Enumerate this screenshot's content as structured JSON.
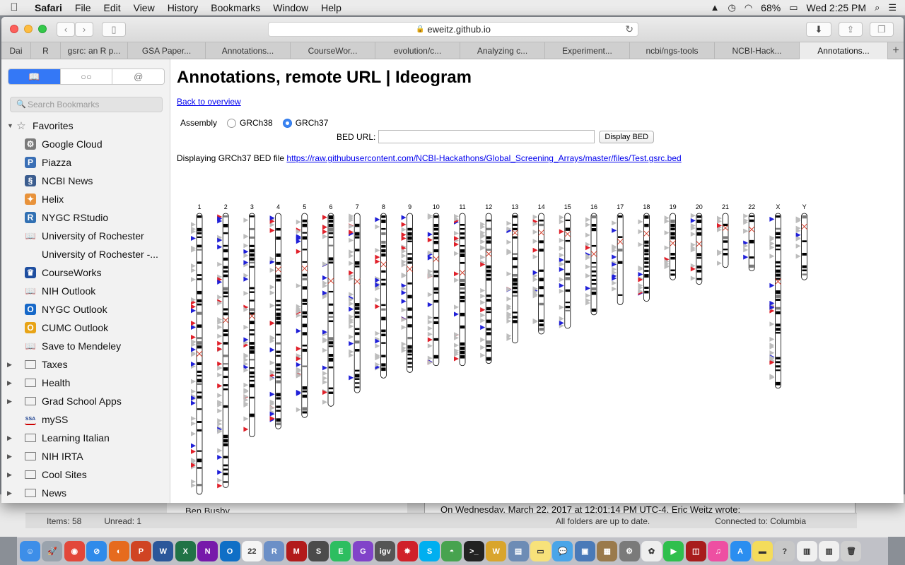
{
  "menubar": {
    "app": "Safari",
    "items": [
      "File",
      "Edit",
      "View",
      "History",
      "Bookmarks",
      "Window",
      "Help"
    ],
    "battery": "68%",
    "clock": "Wed 2:25 PM"
  },
  "browser": {
    "url": "eweitz.github.io",
    "tabs": [
      "Dai",
      "R",
      "gsrc: an R p...",
      "GSA Paper...",
      "Annotations...",
      "CourseWor...",
      "evolution/c...",
      "Analyzing c...",
      "Experiment...",
      "ncbi/ngs-tools",
      "NCBI-Hack...",
      "Annotations..."
    ],
    "new_tab": "+"
  },
  "sidebar": {
    "search_placeholder": "Search Bookmarks",
    "segments": [
      "book-icon",
      "glasses-icon",
      "at-icon"
    ],
    "at_label": "@",
    "favorites_label": "Favorites",
    "items": [
      {
        "label": "Google Cloud",
        "icon": "gear-icon",
        "color": "#7a7a7a",
        "glyph": "⚙"
      },
      {
        "label": "Piazza",
        "icon": "piazza-icon",
        "color": "#3a6fb5",
        "glyph": "P"
      },
      {
        "label": "NCBI News",
        "icon": "ncbi-icon",
        "color": "#3b5d8f",
        "glyph": "§"
      },
      {
        "label": "Helix",
        "icon": "helix-icon",
        "color": "#e8923a",
        "glyph": "✦"
      },
      {
        "label": "NYGC RStudio",
        "icon": "rstudio-icon",
        "color": "#3170b3",
        "glyph": "R"
      },
      {
        "label": "University of Rochester",
        "icon": "book-icon",
        "color": "",
        "glyph": "📖"
      },
      {
        "label": "University of Rochester -...",
        "icon": "",
        "color": "",
        "glyph": ""
      },
      {
        "label": "CourseWorks",
        "icon": "crown-icon",
        "color": "#1f4fa0",
        "glyph": "♛"
      },
      {
        "label": "NIH Outlook",
        "icon": "book-icon",
        "color": "",
        "glyph": "📖"
      },
      {
        "label": "NYGC Outlook",
        "icon": "outlook-icon",
        "color": "#1668c8",
        "glyph": "O"
      },
      {
        "label": "CUMC Outlook",
        "icon": "outlook-icon",
        "color": "#e8a417",
        "glyph": "O"
      },
      {
        "label": "Save to Mendeley",
        "icon": "book-icon",
        "color": "",
        "glyph": "📖"
      }
    ],
    "folders": [
      "Taxes",
      "Health",
      "Grad School Apps",
      "mySS",
      "Learning Italian",
      "NIH IRTA",
      "Cool Sites",
      "News"
    ],
    "myss_badge": "SSA"
  },
  "page": {
    "title": "Annotations, remote URL | Ideogram",
    "back_link": "Back to overview",
    "assembly_label": "Assembly",
    "assembly_options": [
      "GRCh38",
      "GRCh37"
    ],
    "assembly_selected": "GRCh37",
    "bed_url_label": "BED URL:",
    "bed_url_value": "",
    "display_button": "Display BED",
    "displaying_prefix": "Displaying GRCh37 BED file",
    "displaying_link": "https://raw.githubusercontent.com/NCBI-Hackathons/Global_Screening_Arrays/master/files/Test.gsrc.bed"
  },
  "ideogram": {
    "chromosomes": [
      {
        "name": "1",
        "length": 249,
        "centromere": 0.5
      },
      {
        "name": "2",
        "length": 243,
        "centromere": 0.39
      },
      {
        "name": "3",
        "length": 198,
        "centromere": 0.46
      },
      {
        "name": "4",
        "length": 191,
        "centromere": 0.26
      },
      {
        "name": "5",
        "length": 181,
        "centromere": 0.27
      },
      {
        "name": "6",
        "length": 171,
        "centromere": 0.35
      },
      {
        "name": "7",
        "length": 159,
        "centromere": 0.38
      },
      {
        "name": "8",
        "length": 146,
        "centromere": 0.31
      },
      {
        "name": "9",
        "length": 141,
        "centromere": 0.35
      },
      {
        "name": "10",
        "length": 135,
        "centromere": 0.3
      },
      {
        "name": "11",
        "length": 135,
        "centromere": 0.39
      },
      {
        "name": "12",
        "length": 133,
        "centromere": 0.27
      },
      {
        "name": "13",
        "length": 115,
        "centromere": 0.15
      },
      {
        "name": "14",
        "length": 107,
        "centromere": 0.16
      },
      {
        "name": "15",
        "length": 102,
        "centromere": 0.18
      },
      {
        "name": "16",
        "length": 90,
        "centromere": 0.4
      },
      {
        "name": "17",
        "length": 81,
        "centromere": 0.31
      },
      {
        "name": "18",
        "length": 78,
        "centromere": 0.23
      },
      {
        "name": "19",
        "length": 59,
        "centromere": 0.45
      },
      {
        "name": "20",
        "length": 63,
        "centromere": 0.43
      },
      {
        "name": "21",
        "length": 48,
        "centromere": 0.27
      },
      {
        "name": "22",
        "length": 51,
        "centromere": 0.28
      },
      {
        "name": "X",
        "length": 155,
        "centromere": 0.39
      },
      {
        "name": "Y",
        "length": 59,
        "centromere": 0.2
      }
    ],
    "colors": {
      "gain": "#e0202a",
      "loss": "#2020d8",
      "neutral": "#bdbdbd",
      "band": "#000000",
      "acen": "#d0331f",
      "gvar": "#c8c8f0"
    }
  },
  "mail": {
    "items_count": "Items: 58",
    "unread": "Unread: 1",
    "sync": "All folders are up to date.",
    "connection": "Connected to: Columbia",
    "quote": "On Wednesday, March 22, 2017 at 12:01:14 PM UTC-4, Eric Weitz wrote:",
    "sender": "Ben Busby"
  },
  "dock": {
    "apps": [
      {
        "name": "finder-icon",
        "color": "#3d8ee8",
        "glyph": "☺"
      },
      {
        "name": "launchpad-icon",
        "color": "#9aa3ad",
        "glyph": "🚀"
      },
      {
        "name": "chrome-icon",
        "color": "#e2473a",
        "glyph": "◉"
      },
      {
        "name": "safari-icon",
        "color": "#2f8bea",
        "glyph": "⊘"
      },
      {
        "name": "firefox-icon",
        "color": "#e66b1e",
        "glyph": "◐"
      },
      {
        "name": "powerpoint-icon",
        "color": "#d04423",
        "glyph": "P"
      },
      {
        "name": "word-icon",
        "color": "#2b579a",
        "glyph": "W"
      },
      {
        "name": "excel-icon",
        "color": "#217346",
        "glyph": "X"
      },
      {
        "name": "onenote-icon",
        "color": "#7719aa",
        "glyph": "N"
      },
      {
        "name": "outlook-icon",
        "color": "#0f6fc6",
        "glyph": "O"
      },
      {
        "name": "calendar-icon",
        "color": "#f5f5f5",
        "glyph": "22"
      },
      {
        "name": "r-icon",
        "color": "#6b8fc7",
        "glyph": "R"
      },
      {
        "name": "mendeley-icon",
        "color": "#b21b1b",
        "glyph": "M"
      },
      {
        "name": "sublime-icon",
        "color": "#4b4b4b",
        "glyph": "S"
      },
      {
        "name": "evernote-icon",
        "color": "#2dbe60",
        "glyph": "E"
      },
      {
        "name": "github-icon",
        "color": "#8143c9",
        "glyph": "G"
      },
      {
        "name": "igv-icon",
        "color": "#555",
        "glyph": "igv"
      },
      {
        "name": "settings-icon",
        "color": "#d0212a",
        "glyph": "✸"
      },
      {
        "name": "skype-icon",
        "color": "#00aff0",
        "glyph": "S"
      },
      {
        "name": "network-icon",
        "color": "#47a34f",
        "glyph": "◓"
      },
      {
        "name": "terminal-icon",
        "color": "#222",
        "glyph": ">_"
      },
      {
        "name": "wunderlist-icon",
        "color": "#d9a52c",
        "glyph": "W"
      },
      {
        "name": "preview-icon",
        "color": "#6d8cb5",
        "glyph": "▤"
      },
      {
        "name": "notes-icon",
        "color": "#f7e27a",
        "glyph": "▭"
      },
      {
        "name": "messages-icon",
        "color": "#4aa5e8",
        "glyph": "💬"
      },
      {
        "name": "photo-icon",
        "color": "#4a7ab8",
        "glyph": "▣"
      },
      {
        "name": "archive-icon",
        "color": "#9a7a4c",
        "glyph": "▦"
      },
      {
        "name": "system-prefs-icon",
        "color": "#7a7a7a",
        "glyph": "⚙"
      },
      {
        "name": "photos-icon",
        "color": "#eeeeee",
        "glyph": "✿"
      },
      {
        "name": "facetime-icon",
        "color": "#2fbf4d",
        "glyph": "▶"
      },
      {
        "name": "photo-booth-icon",
        "color": "#a81c1c",
        "glyph": "◫"
      },
      {
        "name": "itunes-icon",
        "color": "#ee4fa2",
        "glyph": "♫"
      },
      {
        "name": "app-store-icon",
        "color": "#2a8ef0",
        "glyph": "A"
      },
      {
        "name": "stickies-icon",
        "color": "#f4dc5b",
        "glyph": "▬"
      },
      {
        "name": "help-icon",
        "color": "#c8c8c8",
        "glyph": "?"
      },
      {
        "name": "document-icon",
        "color": "#f0f0f0",
        "glyph": "▥"
      },
      {
        "name": "document-icon-2",
        "color": "#f0f0f0",
        "glyph": "▥"
      },
      {
        "name": "trash-icon",
        "color": "#cfcfcf",
        "glyph": "🗑"
      }
    ]
  }
}
